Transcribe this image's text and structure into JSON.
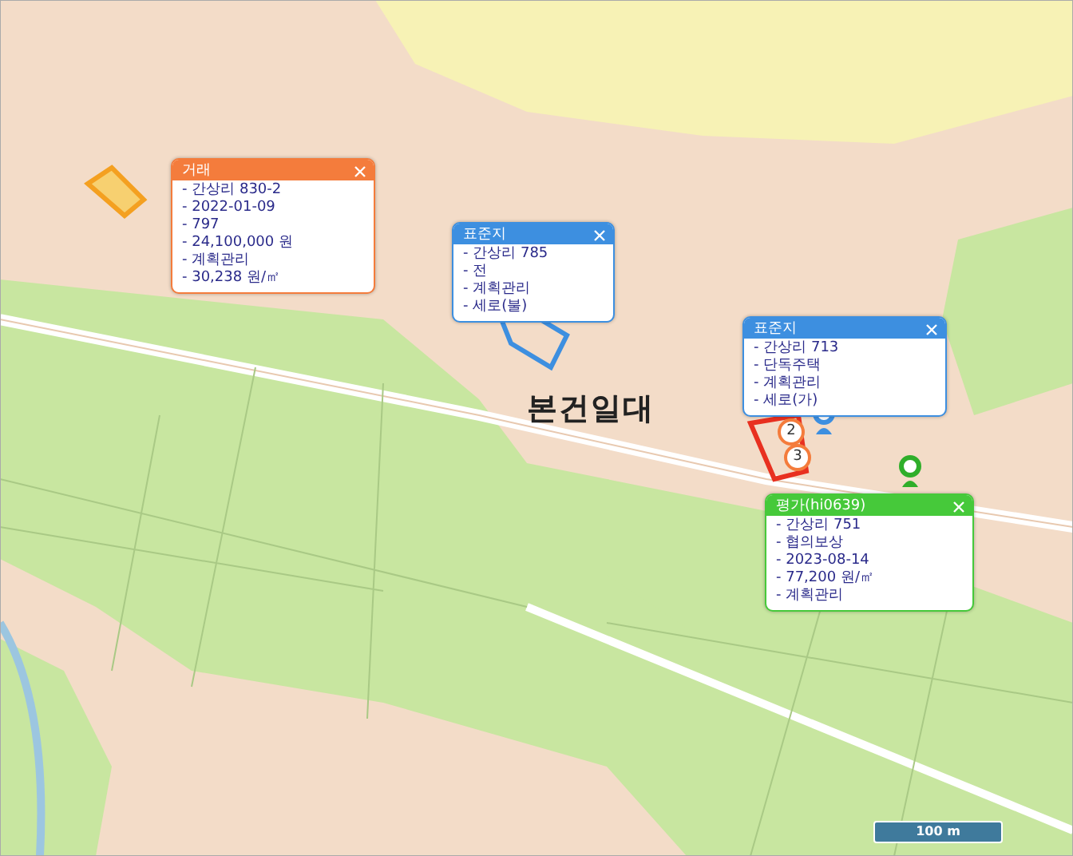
{
  "popups": [
    {
      "title": "거래",
      "color": "#f47c3c",
      "lines": [
        "- 간상리 830-2",
        "- 2022-01-09",
        "- 797",
        "- 24,100,000 원",
        "- 계획관리",
        "- 30,238 원/㎡"
      ]
    },
    {
      "title": "표준지",
      "color": "#3d8fe0",
      "lines": [
        "- 간상리 785",
        "- 전",
        "- 계획관리",
        "- 세로(불)"
      ]
    },
    {
      "title": "표준지",
      "color": "#3d8fe0",
      "lines": [
        "- 간상리 713",
        "- 단독주택",
        "- 계획관리",
        "- 세로(가)"
      ]
    },
    {
      "title": "평가(hi0639)",
      "color": "#46c93a",
      "lines": [
        "- 간상리 751",
        "- 협의보상",
        "- 2023-08-14",
        "- 77,200 원/㎡",
        "- 계획관리"
      ]
    }
  ],
  "area_label": "본건일대",
  "numbered_markers": [
    {
      "label": "2"
    },
    {
      "label": "3"
    }
  ],
  "scale": "100 m"
}
